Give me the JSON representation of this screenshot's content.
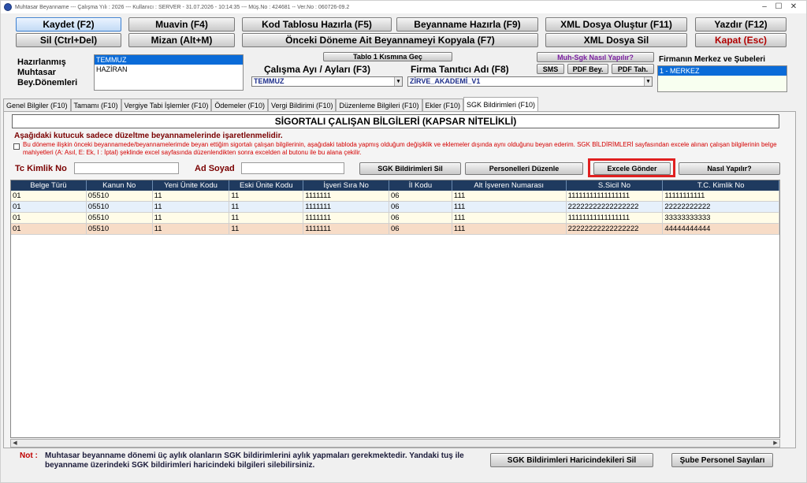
{
  "window": {
    "title": "Muhtasar Beyanname  ---  Çalışma Yılı : 2026  ---  Kullanıcı : SERVER - 31.07.2026 - 10:14:35 --- Müş.No : 424681 -- Ver.No : 060726-09.2"
  },
  "toolbar": {
    "row1": [
      "Kaydet (F2)",
      "Muavin (F4)",
      "Kod Tablosu Hazırla (F5)",
      "Beyanname Hazırla (F9)",
      "XML Dosya Oluştur (F11)",
      "Yazdır (F12)"
    ],
    "row2": [
      "Sil (Ctrl+Del)",
      "Mizan (Alt+M)",
      "Önceki Döneme Ait Beyannameyi Kopyala (F7)",
      "XML Dosya Sil",
      "Kapat (Esc)"
    ]
  },
  "prepared": {
    "label_line1": "Hazırlanmış",
    "label_line2": "Muhtasar",
    "label_line3": "Bey.Dönemleri",
    "items": [
      "TEMMUZ",
      "HAZİRAN"
    ],
    "selected": "TEMMUZ"
  },
  "tablo_button": "Tablo 1 Kısmına Geç",
  "work_period": {
    "label": "Çalışma Ayı / Ayları (F3)",
    "value": "TEMMUZ"
  },
  "firm": {
    "label": "Firma Tanıtıcı Adı (F8)",
    "value": "ZİRVE_AKADEMİ_V1"
  },
  "small_buttons": {
    "how": "Muh-Sgk Nasıl Yapılır?",
    "sms": "SMS",
    "pdf_bey": "PDF Bey.",
    "pdf_tah": "PDF Tah."
  },
  "branches": {
    "label": "Firmanın Merkez ve Şubeleri",
    "items": [
      "1 - MERKEZ"
    ]
  },
  "tabs": [
    "Genel Bilgiler (F10)",
    "Tamamı (F10)",
    "Vergiye Tabi İşlemler (F10)",
    "Ödemeler (F10)",
    "Vergi Bildirimi (F10)",
    "Düzenleme Bilgileri (F10)",
    "Ekler (F10)",
    "SGK Bildirimleri (F10)"
  ],
  "active_tab": "SGK Bildirimleri (F10)",
  "section_title": "SİGORTALI ÇALIŞAN BİLGİLERİ (KAPSAR NİTELİKLİ)",
  "warning_title": "Aşağıdaki kutucuk sadece düzeltme beyannamelerinde işaretlenmelidir.",
  "warning_text": "Bu döneme ilişkin önceki beyannamede/beyannamelerimde beyan ettiğim sigortalı çalışan bilgilerinin, aşağıdaki tabloda yapmış olduğum değişiklik ve eklemeler dışında aynı olduğunu beyan ederim. SGK BİLDİRİMLERİ sayfasından excele alınan çalışan bilgilerinin belge mahiyetleri (A: Asıl, E: Ek, I : İptal) şeklinde excel sayfasında düzenlendikten sonra excelden al butonu ile bu alana çekilir.",
  "filters": {
    "tc_label": "Tc Kimlik No",
    "name_label": "Ad Soyad",
    "tc_value": "",
    "name_value": ""
  },
  "actions": {
    "sgk_delete": "SGK Bildirimleri Sil",
    "edit_staff": "Personelleri Düzenle",
    "excel_send": "Excele Gönder",
    "how_to": "Nasıl Yapılır?"
  },
  "table": {
    "columns": [
      "Belge Türü",
      "Kanun No",
      "Yeni Ünite Kodu",
      "Eski Ünite Kodu",
      "İşveri Sıra No",
      "İl Kodu",
      "Alt İşveren Numarası",
      "S.Sicil No",
      "T.C. Kimlik No"
    ],
    "rows": [
      [
        "01",
        "05510",
        "11",
        "11",
        "1111111",
        "06",
        "111",
        "11111111111111111",
        "11111111111"
      ],
      [
        "01",
        "05510",
        "11",
        "11",
        "1111111",
        "06",
        "111",
        "22222222222222222",
        "22222222222"
      ],
      [
        "01",
        "05510",
        "11",
        "11",
        "1111111",
        "06",
        "111",
        "11111111111111111",
        "33333333333"
      ],
      [
        "01",
        "05510",
        "11",
        "11",
        "1111111",
        "06",
        "111",
        "22222222222222222",
        "44444444444"
      ]
    ],
    "row_colors": [
      "#fffce8",
      "#e6f0fb",
      "#fffce8",
      "#f7dcc7"
    ]
  },
  "footer": {
    "note_label": "Not :",
    "note_text": "Muhtasar beyanname dönemi üç aylık olanların SGK bildirimlerini aylık yapmaları gerekmektedir. Yandaki tuş ile beyanname üzerindeki SGK bildirimleri haricindeki bilgileri silebilirsiniz.",
    "delete_other": "SGK Bildirimleri Haricindekileri Sil",
    "branch_count": "Şube Personel Sayıları"
  },
  "colors": {
    "grid_header": "#1f3a5f",
    "selection": "#0a6bd8",
    "highlight": "#e02020",
    "warning": "#d40000"
  }
}
